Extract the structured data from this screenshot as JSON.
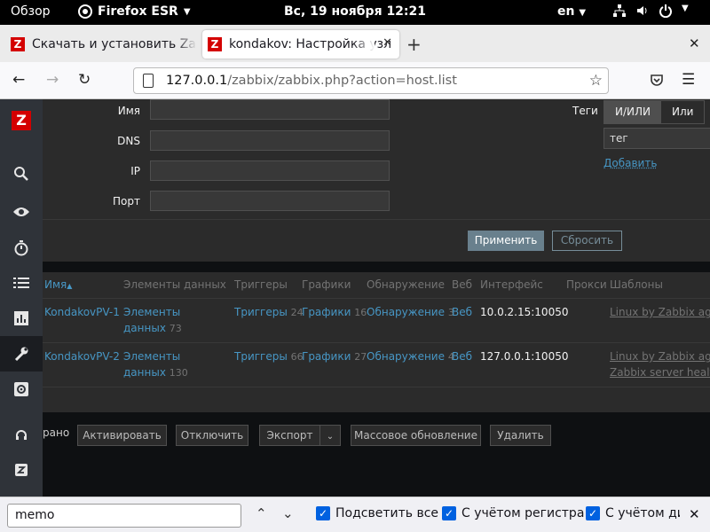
{
  "topbar": {
    "overview": "Обзор",
    "app_name": "Firefox ESR",
    "clock": "Вс, 19 ноября  12:21",
    "lang": "en"
  },
  "tabs": [
    {
      "title": "Скачать и установить Za"
    },
    {
      "title": "kondakov: Настройка узл"
    }
  ],
  "url": {
    "host": "127.0.0.1",
    "path": "/zabbix/zabbix.php?action=host.list"
  },
  "filter": {
    "name_label": "Имя",
    "dns_label": "DNS",
    "ip_label": "IP",
    "port_label": "Порт",
    "tags_label": "Теги",
    "tag_and_or": "И/ИЛИ",
    "tag_or": "Или",
    "tag_value": "тег",
    "add_link": "Добавить",
    "apply": "Применить",
    "reset": "Сбросить"
  },
  "table": {
    "headers": {
      "name": "Имя",
      "sort_arrow": "▲",
      "items": "Элементы данных",
      "triggers": "Триггеры",
      "graphs": "Графики",
      "discovery": "Обнаружение",
      "web": "Веб",
      "interface": "Интерфейс",
      "proxy": "Прокси",
      "templates": "Шаблоны"
    },
    "rows": [
      {
        "name": "KondakovPV-1",
        "items_1": "Элементы",
        "items_2": "данных",
        "items_count": "73",
        "triggers": "Триггеры",
        "triggers_count": "24",
        "graphs": "Графики",
        "graphs_count": "16",
        "discovery": "Обнаружение",
        "discovery_count": "3",
        "web": "Веб",
        "interface": "10.0.2.15:10050",
        "template_1": "Linux by Zabbix agen",
        "template_2": ""
      },
      {
        "name": "KondakovPV-2",
        "items_1": "Элементы",
        "items_2": "данных",
        "items_count": "130",
        "triggers": "Триггеры",
        "triggers_count": "66",
        "graphs": "Графики",
        "graphs_count": "27",
        "discovery": "Обнаружение",
        "discovery_count": "4",
        "web": "Веб",
        "interface": "127.0.0.1:10050",
        "template_1": "Linux by Zabbix agen",
        "template_2": "Zabbix server health"
      }
    ]
  },
  "actions": {
    "selected_text": "рано",
    "enable": "Активировать",
    "disable": "Отключить",
    "export": "Экспорт",
    "mass_update": "Массовое обновление",
    "delete": "Удалить"
  },
  "findbar": {
    "query": "memo",
    "highlight_all": "Подсветить все",
    "match_case": "С учётом регистра",
    "match_diacritics": "С учётом ди"
  },
  "colors": {
    "zabbix_red": "#d40000",
    "link_blue": "#4796c4",
    "sidebar_bg": "#2f3339"
  }
}
